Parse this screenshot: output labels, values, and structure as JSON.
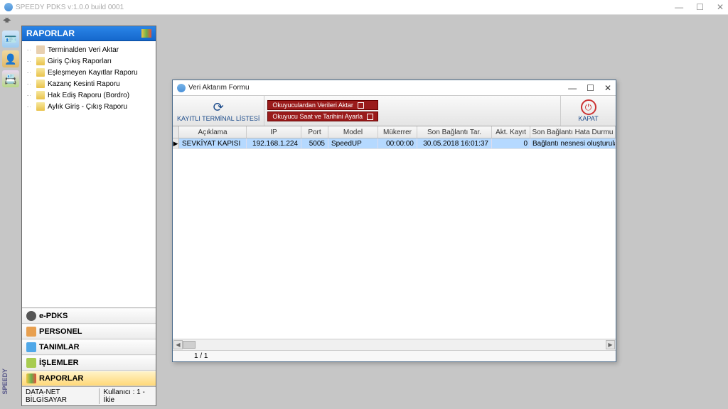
{
  "app_title": "SPEEDY PDKS v:1.0.0 build 0001",
  "sidebar": {
    "header": "RAPORLAR",
    "items": [
      "Terminalden Veri Aktar",
      "Giriş Çıkış Raporları",
      "Eşleşmeyen Kayıtlar Raporu",
      "Kazanç Kesinti Raporu",
      "Hak Ediş Raporu (Bordro)",
      "Aylık Giriş - Çıkış Raporu"
    ],
    "categories": {
      "epdks": "e-PDKS",
      "personel": "PERSONEL",
      "tanimlar": "TANIMLAR",
      "islemler": "İŞLEMLER",
      "raporlar": "RAPORLAR"
    }
  },
  "status": {
    "host": "DATA-NET BİLGİSAYAR",
    "user": "Kullanıcı : 1 - İkie"
  },
  "dialog": {
    "title": "Veri Aktarım Formu",
    "btn_list": "KAYITLI  TERMİNAL  LİSTESİ",
    "red1": "Okuyuculardan Verileri Aktar",
    "red2": "Okuyucu Saat ve Tarihini Ayarla",
    "btn_close": "KAPAT",
    "columns": {
      "aciklama": "Açıklama",
      "ip": "IP",
      "port": "Port",
      "model": "Model",
      "mukerrer": "Mükerrer",
      "son": "Son Bağlantı Tar.",
      "akt": "Akt. Kayıt",
      "hata": "Son Bağlantı Hata Durmu"
    },
    "row": {
      "aciklama": "SEVKİYAT KAPISI",
      "ip": "192.168.1.224",
      "port": "5005",
      "model": "SpeedUP",
      "mukerrer": "00:00:00",
      "son": "30.05.2018 16:01:37",
      "akt": "0",
      "hata": "Bağlantı nesnesi oluşturulamadı."
    },
    "pager": "1 / 1"
  }
}
